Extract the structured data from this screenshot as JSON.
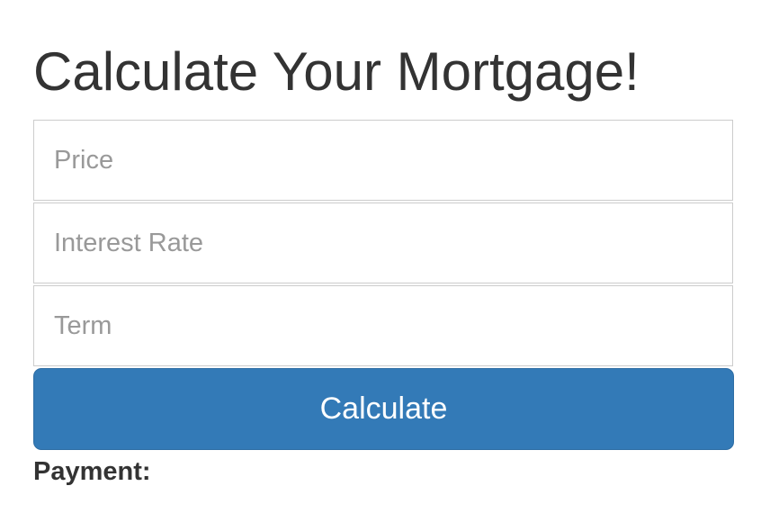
{
  "page": {
    "title": "Calculate Your Mortgage!"
  },
  "form": {
    "price": {
      "placeholder": "Price",
      "value": ""
    },
    "interest_rate": {
      "placeholder": "Interest Rate",
      "value": ""
    },
    "term": {
      "placeholder": "Term",
      "value": ""
    },
    "submit_label": "Calculate"
  },
  "result": {
    "label": "Payment:",
    "value": ""
  },
  "colors": {
    "button_bg": "#337ab7",
    "button_border": "#2e6da4",
    "text": "#333333",
    "placeholder": "#999999",
    "input_border": "#cccccc"
  }
}
